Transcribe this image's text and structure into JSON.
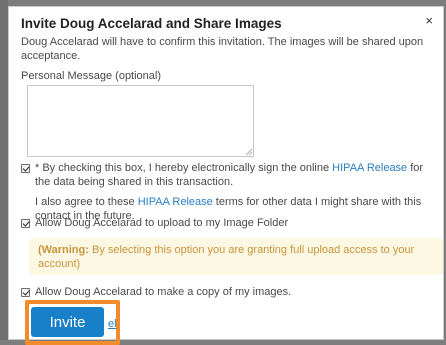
{
  "dialog": {
    "title": "Invite Doug Accelarad and Share Images",
    "close_glyph": "×",
    "intro": "Doug Accelarad will have to confirm this invitation. The images will be shared upon acceptance."
  },
  "personal_message": {
    "label": "Personal Message (optional)",
    "value": "",
    "placeholder": ""
  },
  "hipaa_consent": {
    "checked": true,
    "text_before": "* By checking this box, I hereby electronically sign the online ",
    "link": "HIPAA Release",
    "text_after": " for the data being shared in this transaction.",
    "extra_before": "I also agree to these ",
    "extra_link": "HIPAA Release",
    "extra_after": " terms for other data I might share with this contact in the future."
  },
  "upload_permission": {
    "checked": true,
    "label": "Allow Doug Accelarad to upload to my Image Folder"
  },
  "warning": {
    "strong": "(Warning:",
    "text": " By selecting this option you are granting full upload access to your account)"
  },
  "copy_permission": {
    "checked": true,
    "label": "Allow Doug Accelarad to make a copy of my images."
  },
  "actions": {
    "invite_label": "Invite",
    "cancel_label": "el"
  },
  "colors": {
    "link": "#2a7ec0",
    "primary_button": "#1780c8",
    "highlight": "#f28b2c",
    "warning_bg": "#fcf8e3",
    "warning_text": "#c8953d"
  }
}
